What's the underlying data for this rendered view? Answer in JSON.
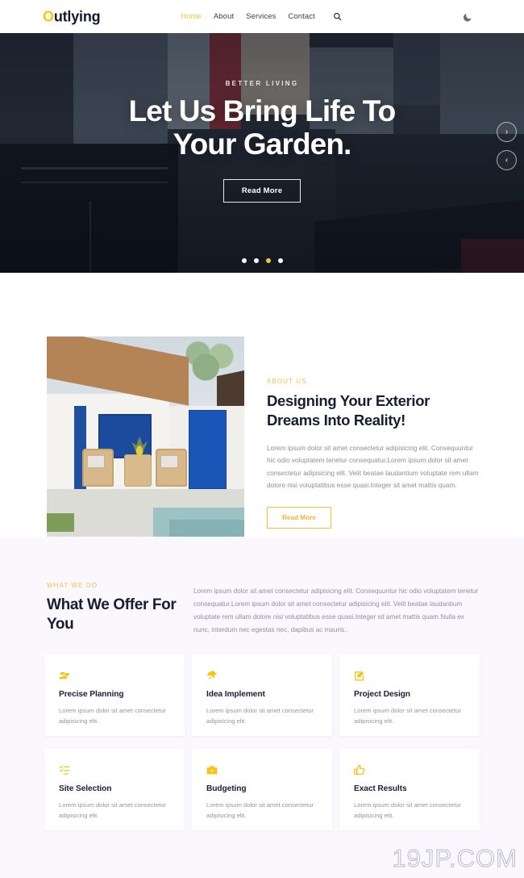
{
  "header": {
    "logo_first": "O",
    "logo_rest": "utlying",
    "nav": [
      {
        "label": "Home",
        "active": true
      },
      {
        "label": "About",
        "active": false
      },
      {
        "label": "Services",
        "active": false
      },
      {
        "label": "Contact",
        "active": false
      }
    ],
    "search_icon": "search-icon",
    "theme_toggle_icon": "moon-icon"
  },
  "hero": {
    "eyebrow": "BETTER LIVING",
    "title_line1": "Let Us Bring Life To",
    "title_line2": "Your Garden.",
    "button_label": "Read More",
    "next_arrow": "›",
    "prev_arrow": "‹",
    "dots": [
      {
        "active": false
      },
      {
        "active": false
      },
      {
        "active": true
      },
      {
        "active": false
      }
    ]
  },
  "about": {
    "eyebrow": "ABOUT US",
    "title": "Designing Your Exterior Dreams Into Reality!",
    "paragraph": "Lorem ipsum dolor sit amet consectetur adipisicing elit. Consequuntur hic odio voluptatem tenetur consequatur.Lorem ipsum dolor sit amet consectetur adipisicing elit. Velit beatae laudantium voluptate rem ullam dolore nisi voluptatibus esse quasi.Integer sit amet mattis quam.",
    "button_label": "Read More",
    "image_alt": "villa-courtyard-photo"
  },
  "services": {
    "eyebrow": "WHAT WE DO",
    "title": "What We Offer For You",
    "paragraph": "Lorem ipsum dolor sit amet consectetur adipisicing elit. Consequuntur hic odio voluptatem tenetur consequatur.Lorem ipsum dolor sit amet consectetur adipisicing elit. Velit beatae laudantium voluptate rem ullam dolore nisi voluptatibus esse quasi.Integer sit amet mattis quam.Nulla ex nunc, interdum nec egestas nec, dapibus ac mauris..",
    "cards": [
      {
        "icon": "coins-icon",
        "title": "Precise Planning",
        "desc": "Lorem ipsum dolor sit amet consectetur adipisicing elit."
      },
      {
        "icon": "push-pin-icon",
        "title": "Idea Implement",
        "desc": "Lorem ipsum dolor sit amet consectetur adipisicing elit."
      },
      {
        "icon": "pencil-square-icon",
        "title": "Project Design",
        "desc": "Lorem ipsum dolor sit amet consectetur adipisicing elit."
      },
      {
        "icon": "list-check-icon",
        "title": "Site Selection",
        "desc": "Lorem ipsum dolor sit amet consectetur adipisicing elit."
      },
      {
        "icon": "briefcase-icon",
        "title": "Budgeting",
        "desc": "Lorem ipsum dolor sit amet consectetur adipisicing elit."
      },
      {
        "icon": "thumbs-up-icon",
        "title": "Exact Results",
        "desc": "Lorem ipsum dolor sit amet consectetur adipisicing elit."
      }
    ]
  },
  "watermark": {
    "text": "19JP.COM"
  },
  "colors": {
    "accent": "#f0c43c",
    "heading": "#181d33",
    "body_text": "#8b8f9c",
    "services_bg": "#faf8fc",
    "hero_overlay": "#0c101a"
  }
}
